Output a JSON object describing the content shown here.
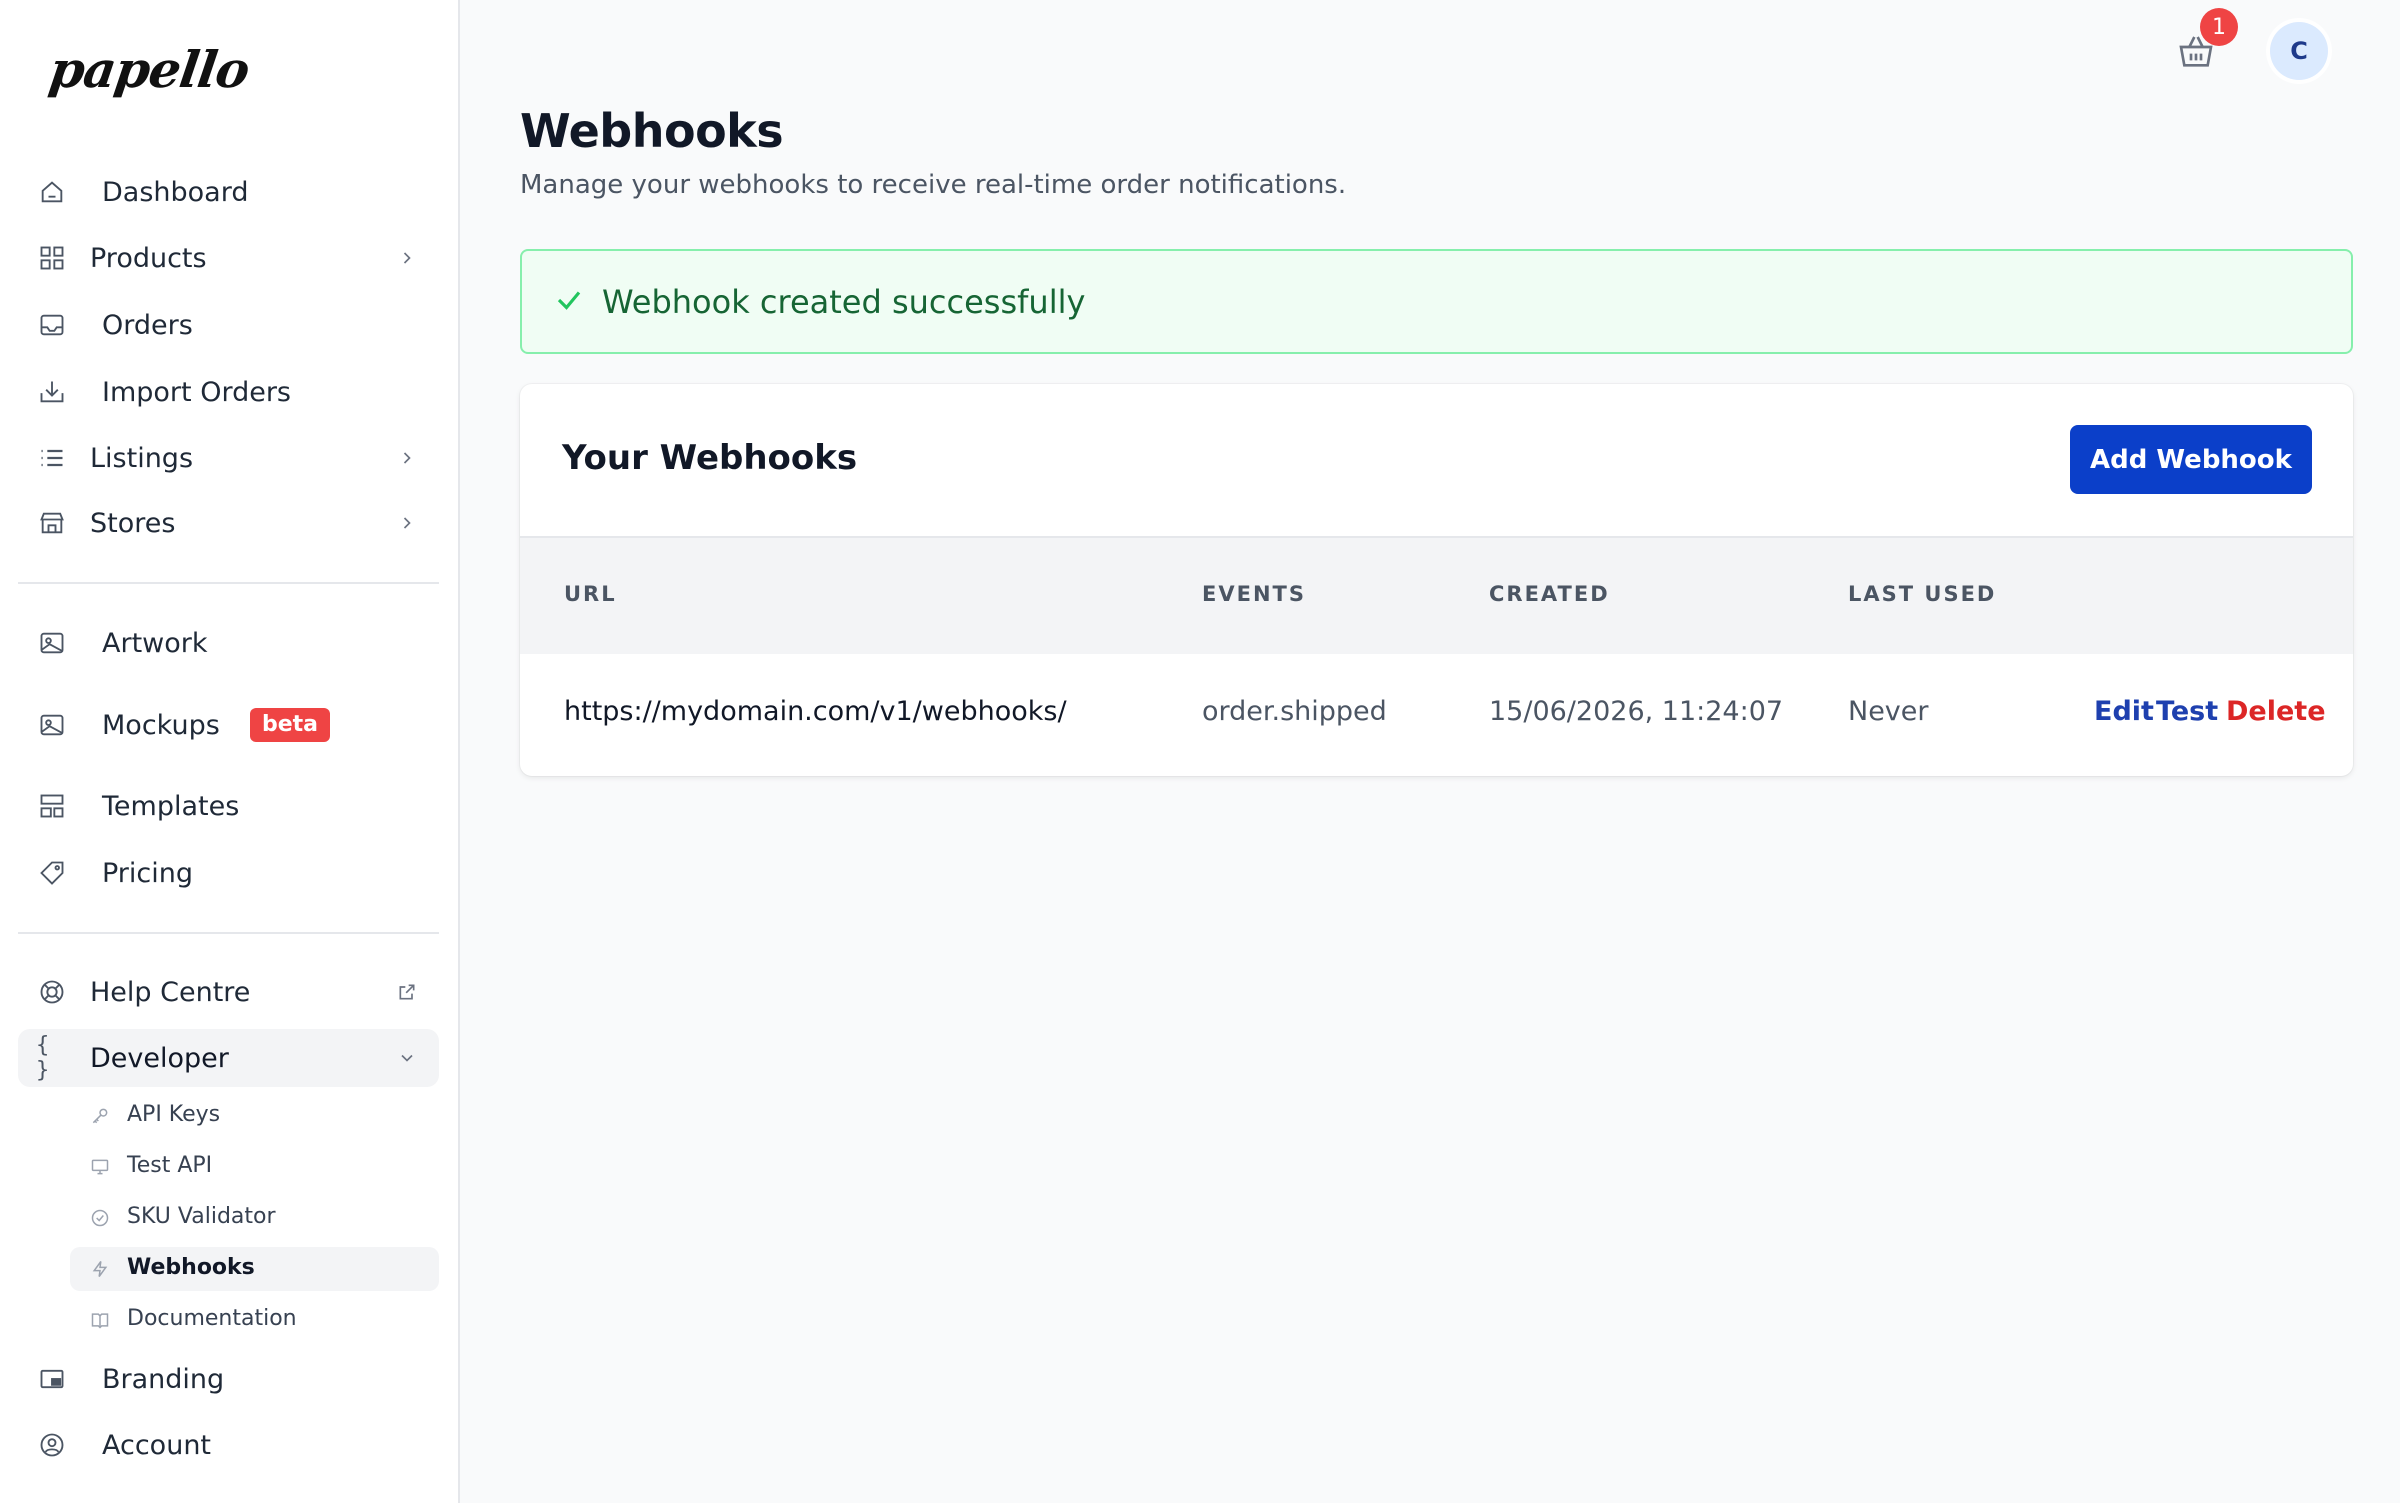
{
  "sidebar": {
    "logo": "papello",
    "items": [
      {
        "label": "Dashboard"
      },
      {
        "label": "Products"
      },
      {
        "label": "Orders"
      },
      {
        "label": "Import Orders"
      },
      {
        "label": "Listings"
      },
      {
        "label": "Stores"
      },
      {
        "label": "Artwork"
      },
      {
        "label": "Mockups",
        "badge": "beta"
      },
      {
        "label": "Templates"
      },
      {
        "label": "Pricing"
      },
      {
        "label": "Help Centre"
      },
      {
        "label": "Developer"
      },
      {
        "label": "Branding"
      },
      {
        "label": "Account"
      }
    ],
    "developer_sub": [
      {
        "label": "API Keys"
      },
      {
        "label": "Test API"
      },
      {
        "label": "SKU Validator"
      },
      {
        "label": "Webhooks"
      },
      {
        "label": "Documentation"
      }
    ]
  },
  "topbar": {
    "cart_count": "1",
    "avatar_initial": "C"
  },
  "page": {
    "title": "Webhooks",
    "subtitle": "Manage your webhooks to receive real-time order notifications."
  },
  "alert": {
    "message": "Webhook created successfully"
  },
  "card": {
    "title": "Your Webhooks",
    "add_button": "Add Webhook",
    "columns": [
      "URL",
      "EVENTS",
      "CREATED",
      "LAST USED"
    ],
    "rows": [
      {
        "url": "https://mydomain.com/v1/webhooks/",
        "events": "order.shipped",
        "created": "15/06/2026, 11:24:07",
        "last_used": "Never",
        "actions": {
          "edit": "Edit",
          "test": "Test",
          "delete": "Delete"
        }
      }
    ]
  },
  "colors": {
    "primary": "#0b3fc9",
    "success_bg": "#f0fdf4",
    "success_border": "#86efac",
    "success_text": "#166534",
    "danger": "#dc2626",
    "link": "#1e40af"
  }
}
